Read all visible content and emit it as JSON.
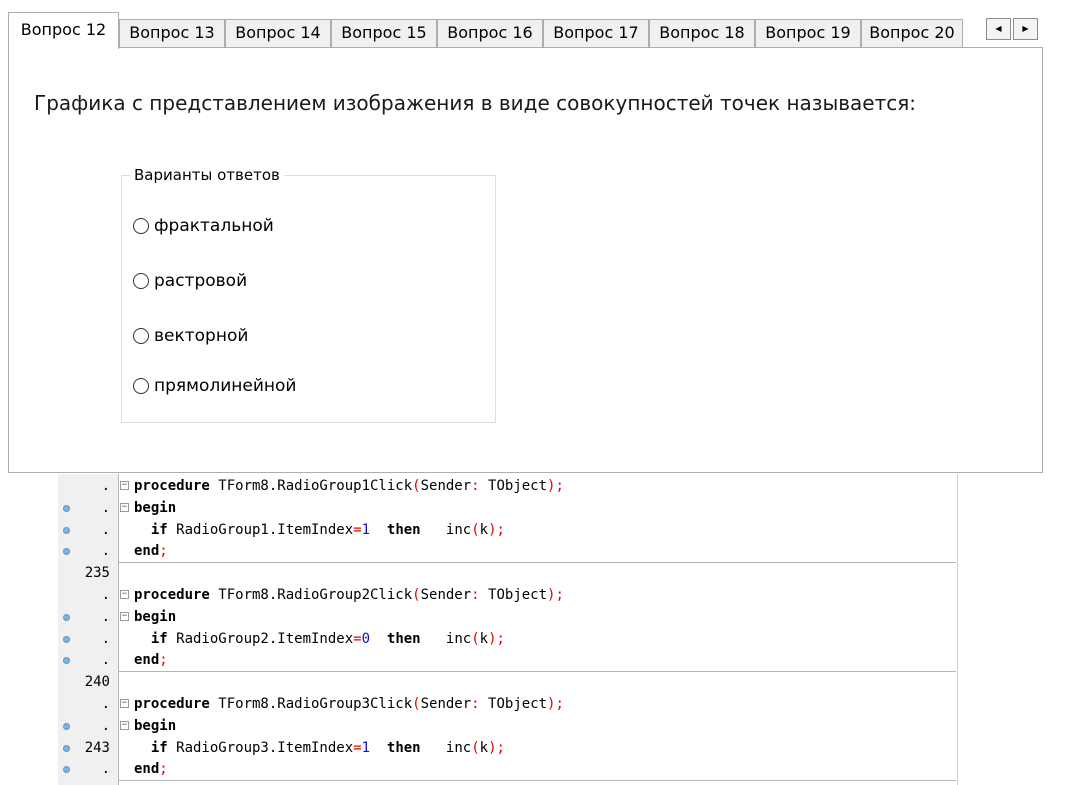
{
  "tabs": [
    {
      "label": "Вопрос 12",
      "active": true
    },
    {
      "label": "Вопрос 13",
      "active": false
    },
    {
      "label": "Вопрос 14",
      "active": false
    },
    {
      "label": "Вопрос 15",
      "active": false
    },
    {
      "label": "Вопрос 16",
      "active": false
    },
    {
      "label": "Вопрос 17",
      "active": false
    },
    {
      "label": "Вопрос 18",
      "active": false
    },
    {
      "label": "Вопрос 19",
      "active": false
    },
    {
      "label": "Вопрос 20",
      "active": false
    }
  ],
  "scroll": {
    "left_icon": "◀",
    "right_icon": "▶"
  },
  "question": {
    "text": "Графика с представлением изображения в виде совокупностей точек называется:"
  },
  "answers": {
    "caption": "Варианты ответов",
    "options": [
      "фрактальной",
      "растровой",
      "векторной",
      "прямолинейной"
    ],
    "selected": null
  },
  "editor": {
    "lines": [
      {
        "ln": ".",
        "bp": false,
        "fold": "−",
        "parts": [
          [
            "kw",
            "procedure"
          ],
          [
            "t",
            " TForm8.RadioGroup1Click"
          ],
          [
            "sym",
            "("
          ],
          [
            "t",
            "Sender"
          ],
          [
            "sym",
            ":"
          ],
          [
            "t",
            " TObject"
          ],
          [
            "sym",
            ");"
          ]
        ]
      },
      {
        "ln": ".",
        "bp": true,
        "fold": "−",
        "parts": [
          [
            "kw",
            "begin"
          ]
        ]
      },
      {
        "ln": ".",
        "bp": true,
        "fold": "",
        "parts": [
          [
            "t",
            "  "
          ],
          [
            "kw",
            "if"
          ],
          [
            "t",
            " RadioGroup1.ItemIndex"
          ],
          [
            "sym",
            "="
          ],
          [
            "num",
            "1"
          ],
          [
            "t",
            "  "
          ],
          [
            "kw",
            "then"
          ],
          [
            "t",
            "   inc"
          ],
          [
            "sym",
            "("
          ],
          [
            "t",
            "k"
          ],
          [
            "sym",
            ");"
          ]
        ]
      },
      {
        "ln": ".",
        "bp": true,
        "fold": "",
        "parts": [
          [
            "kw",
            "end"
          ],
          [
            "sym",
            ";"
          ]
        ]
      },
      {
        "ln": "235",
        "bp": false,
        "fold": "",
        "parts": []
      },
      {
        "ln": ".",
        "bp": false,
        "fold": "−",
        "parts": [
          [
            "kw",
            "procedure"
          ],
          [
            "t",
            " TForm8.RadioGroup2Click"
          ],
          [
            "sym",
            "("
          ],
          [
            "t",
            "Sender"
          ],
          [
            "sym",
            ":"
          ],
          [
            "t",
            " TObject"
          ],
          [
            "sym",
            ");"
          ]
        ]
      },
      {
        "ln": ".",
        "bp": true,
        "fold": "−",
        "parts": [
          [
            "kw",
            "begin"
          ]
        ]
      },
      {
        "ln": ".",
        "bp": true,
        "fold": "",
        "parts": [
          [
            "t",
            "  "
          ],
          [
            "kw",
            "if"
          ],
          [
            "t",
            " RadioGroup2.ItemIndex"
          ],
          [
            "sym",
            "="
          ],
          [
            "num",
            "0"
          ],
          [
            "t",
            "  "
          ],
          [
            "kw",
            "then"
          ],
          [
            "t",
            "   inc"
          ],
          [
            "sym",
            "("
          ],
          [
            "t",
            "k"
          ],
          [
            "sym",
            ");"
          ]
        ]
      },
      {
        "ln": ".",
        "bp": true,
        "fold": "",
        "parts": [
          [
            "kw",
            "end"
          ],
          [
            "sym",
            ";"
          ]
        ]
      },
      {
        "ln": "240",
        "bp": false,
        "fold": "",
        "parts": []
      },
      {
        "ln": ".",
        "bp": false,
        "fold": "−",
        "parts": [
          [
            "kw",
            "procedure"
          ],
          [
            "t",
            " TForm8.RadioGroup3Click"
          ],
          [
            "sym",
            "("
          ],
          [
            "t",
            "Sender"
          ],
          [
            "sym",
            ":"
          ],
          [
            "t",
            " TObject"
          ],
          [
            "sym",
            ");"
          ]
        ]
      },
      {
        "ln": ".",
        "bp": true,
        "fold": "−",
        "parts": [
          [
            "kw",
            "begin"
          ]
        ]
      },
      {
        "ln": "243",
        "bp": true,
        "fold": "",
        "parts": [
          [
            "t",
            "  "
          ],
          [
            "kw",
            "if"
          ],
          [
            "t",
            " RadioGroup3.ItemIndex"
          ],
          [
            "sym",
            "="
          ],
          [
            "num",
            "1"
          ],
          [
            "t",
            "  "
          ],
          [
            "kw",
            "then"
          ],
          [
            "t",
            "   inc"
          ],
          [
            "sym",
            "("
          ],
          [
            "t",
            "k"
          ],
          [
            "sym",
            ");"
          ]
        ]
      },
      {
        "ln": ".",
        "bp": true,
        "fold": "",
        "parts": [
          [
            "kw",
            "end"
          ],
          [
            "sym",
            ";"
          ]
        ]
      }
    ]
  }
}
